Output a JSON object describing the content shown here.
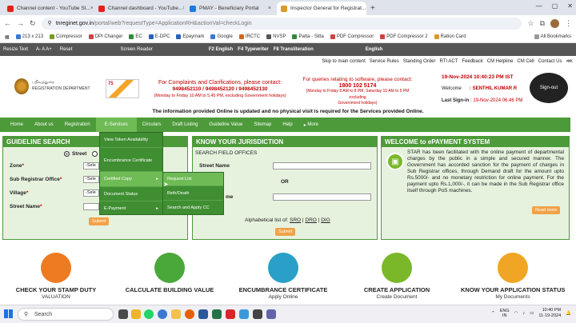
{
  "browser": {
    "tabs": [
      {
        "title": "Channel content - YouTube St...",
        "color": "#e62117"
      },
      {
        "title": "Channel dashboard - YouTube...",
        "color": "#e62117"
      },
      {
        "title": "PMAY - Beneficiary Portal",
        "color": "#1f7ae0"
      },
      {
        "title": "Inspector General for Registrat...",
        "color": "#d79a2b"
      }
    ],
    "url_host": "tnreginet.gov.in",
    "url_path": "/portal/web?requestType=ApplicationRH&actionVal=checkLogin",
    "bookmarks": [
      {
        "label": "213 x 213",
        "color": "#3a78d4"
      },
      {
        "label": "Compressor",
        "color": "#7a9b2a"
      },
      {
        "label": "DPI Changer",
        "color": "#c44"
      },
      {
        "label": "EC",
        "color": "#2f8b3a"
      },
      {
        "label": "E-DPC",
        "color": "#2a62b8"
      },
      {
        "label": "Epaymark",
        "color": "#2a62b8"
      },
      {
        "label": "Google",
        "color": "#3a78d4"
      },
      {
        "label": "IRCTC",
        "color": "#d4661a"
      },
      {
        "label": "NVSP",
        "color": "#555"
      },
      {
        "label": "Patta - Sitta",
        "color": "#2f8b3a"
      },
      {
        "label": "PDF Compressor",
        "color": "#c44"
      },
      {
        "label": "PDF Compressor 2",
        "color": "#c44"
      },
      {
        "label": "Ration Card",
        "color": "#d79a2b"
      }
    ],
    "all_bookmarks": "All Bookmarks"
  },
  "site": {
    "topstrip": {
      "resize": "Resize Text",
      "reset": "Reset",
      "screen_reader": "Screen Reader",
      "f2": "F2 English",
      "f4": "F4 Typewriter",
      "f8": "F8 Transliteration",
      "english": "English"
    },
    "top_links": [
      "Skip to main content",
      "Service Rules",
      "Standing Order",
      "RTI ACT",
      "Feedback",
      "CM Helpline",
      "CM Cell",
      "Contact Us"
    ],
    "logo_name": "பதிவுத்துறை",
    "logo_dept": "REGISTRATION DEPARTMENT",
    "logo75": "75",
    "contact1_title": "For Complaints and Clarifications, please contact:",
    "contact1_numbers": "9498452110 / 9498452120 / 9498452130",
    "contact1_hours": "(Monday to Friday 10 AM to 5.45 PM, excluding Government holidays)",
    "contact2_title": "For queries relating to software, please contact:",
    "contact2_number": "1800 102 5174",
    "contact2_hours1": "(Monday to Friday 8 AM to 8 PM, Saturday 10 AM to 5 PM excluding",
    "contact2_hours2": "Government holidays)",
    "datetime": "19-Nov-2024 10:40:23 PM IST",
    "welcome_label": "Welcome",
    "welcome_user": "SENTHIL KUMAR R",
    "last_sign_label": "Last Sign-in",
    "last_sign_value": "19-Nov-2024 06:46 PM",
    "signout": "Sign-out",
    "info": "The information provided Online is updated and no physical visit is required for the Services provided Online."
  },
  "nav": [
    "Home",
    "About us",
    "Registration",
    "E-Services",
    "Circulars",
    "Draft Listing",
    "Guideline Value",
    "Sitemap",
    "Help",
    "More"
  ],
  "dropdown1": [
    "View Token Availability",
    "Encumbrance Certificate",
    "Certified Copy",
    "Document Status",
    "E-Payment"
  ],
  "dropdown2": [
    "Request List",
    "Birth/Death",
    "Search and Apply CC"
  ],
  "guideline": {
    "title": "GUIDELINE SEARCH",
    "radio1": "Street",
    "radio2": "S",
    "zone": "Zone",
    "sro": "Sub Registrar Office",
    "village": "Village",
    "street": "Street Name",
    "select_ph": "-Sele",
    "submit": "Submit"
  },
  "jurisdiction": {
    "title": "KNOW YOUR JURISDICTION",
    "subtitle": "SEARCH FIELD OFFICES",
    "street": "Street Name",
    "or": "OR",
    "name_suffix": "me",
    "alpha": "Alphabetical list of:",
    "links": [
      "SRO",
      "DRO",
      "DIG"
    ],
    "submit": "Submit"
  },
  "epayment": {
    "title": "WELCOME to ePAYMENT SYSTEM",
    "text": "STAR has been facilitated with the online payment of departmental charges by the public in a simple and secured manner. The Government has accorded sanction for the payment of charges in Sub Registrar offices, through Demand draft for the amount upto Rs.5000/- and no monetary restriction for online payment. For the payment upto Rs.1,000/-, it can be made in the Sub Registrar office itself through PoS machines.",
    "readmore": "Read more"
  },
  "services": [
    {
      "title": "CHECK YOUR STAMP DUTY",
      "sub": "VALUATION",
      "color": "#ee7a22"
    },
    {
      "title": "CALCULATE BUILDING VALUE",
      "sub": "",
      "color": "#4aa83a"
    },
    {
      "title": "ENCUMBRANCE CERTIFICATE",
      "sub": "Apply Online",
      "color": "#2aa0c8"
    },
    {
      "title": "CREATE APPLICATION",
      "sub": "Create Document",
      "color": "#7ab82a"
    },
    {
      "title": "KNOW YOUR APPLICATION STATUS",
      "sub": "My Documents",
      "color": "#f0a524"
    }
  ],
  "taskbar": {
    "search": "Search",
    "lang1": "ENG",
    "lang2": "IN",
    "time": "10:40 PM",
    "date": "11-19-2024"
  }
}
